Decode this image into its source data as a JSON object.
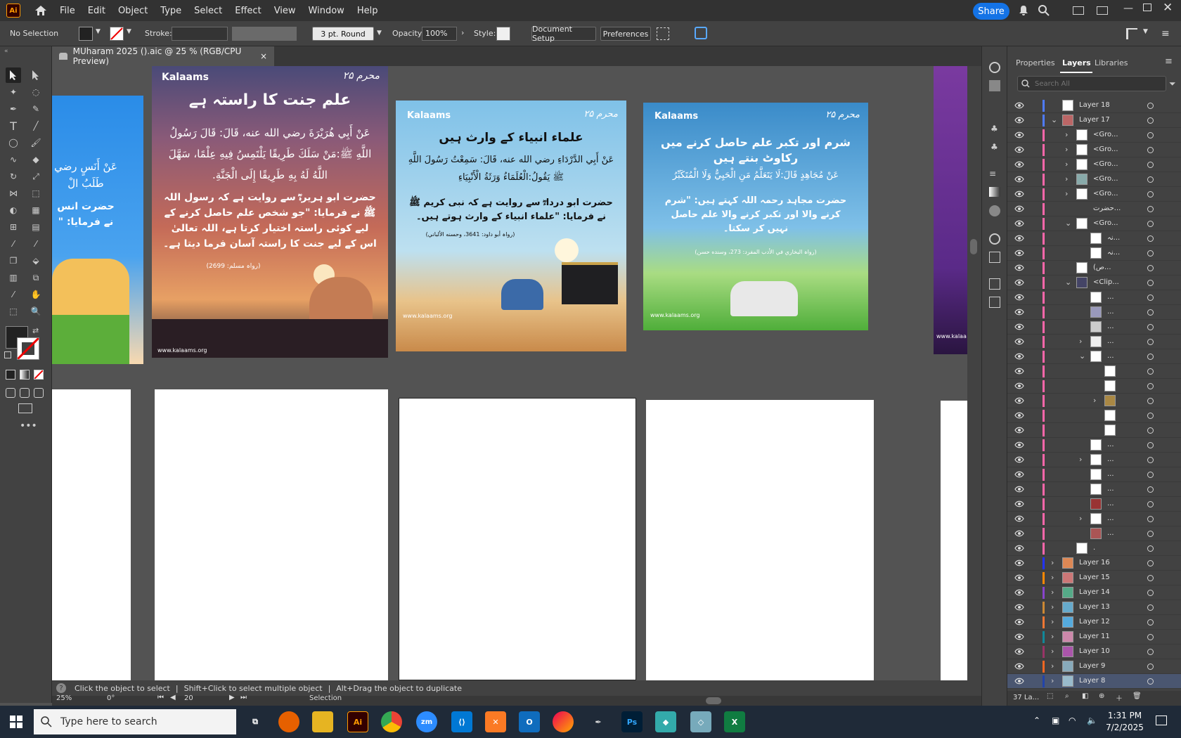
{
  "app": {
    "logo": "Ai",
    "home_icon": "home-icon"
  },
  "menu": [
    "File",
    "Edit",
    "Object",
    "Type",
    "Select",
    "Effect",
    "View",
    "Window",
    "Help"
  ],
  "share_label": "Share",
  "control": {
    "selection": "No Selection",
    "stroke_label": "Stroke:",
    "brush": "3 pt. Round",
    "opacity_label": "Opacity:",
    "opacity_value": "100%",
    "style_label": "Style:",
    "doc_setup": "Document Setup",
    "preferences": "Preferences"
  },
  "document_tab": {
    "title": "MUharam 2025 ().aic @ 25 % (RGB/CPU Preview)",
    "close": "×"
  },
  "artboards": [
    {
      "logo": "Kalaams",
      "title": "علم جنت کا راستہ ہے",
      "arabic": "عَنْ أَبِي هُرَيْرَةَ رضي الله عنه، قَالَ: قَالَ رَسُولُ اللَّهِ ﷺ:مَنْ سَلَكَ طَرِيقًا يَلْتَمِسُ فِيهِ عِلْمًا، سَهَّلَ اللَّهُ لَهُ بِهِ طَرِيقًا إِلَى الْجَنَّةِ.",
      "urdu": "حضرت ابو ہریرہؓ سے روایت ہے کہ رسول اللہ ﷺ نے فرمایا: \"جو شخص علم حاصل کرنے کے لیے کوئی راستہ اختیار کرتا ہے، اللہ تعالیٰ اس کے لیے جنت کا راستہ آسان فرما دیتا ہے۔",
      "ref": "(رواہ مسلم: 2699)",
      "url": "www.kalaams.org"
    },
    {
      "logo": "Kalaams",
      "title": "علماء انبیاء کے وارث ہیں",
      "arabic": "عَنْ أَبِي الدَّرْدَاءِ رضي الله عنه، قَالَ: سَمِعْتُ رَسُولَ اللَّهِ ﷺ يَقُولُ:الْعُلَمَاءُ وَرَثَةُ الْأَنْبِيَاءِ",
      "urdu": "حضرت ابو درداءؓ سے روایت ہے کہ نبی کریم ﷺ نے فرمایا: \"علماء انبیاء کے وارث ہوتے ہیں۔",
      "ref": "(رواہ أبو داود: 3641، وحسنه الألباني)",
      "url": "www.kalaams.org"
    },
    {
      "logo": "Kalaams",
      "title": "شرم اور تکبر علم حاصل کرنے میں رکاوٹ بنتے ہیں",
      "arabic": "عَنْ مُجَاهِدٍ قَالَ:لَا يَتَعَلَّمُ مَنِ الْحَيِيُّ وَلَا الْمُتَكَبِّرُ",
      "urdu": "حضرت مجاہد رحمہ اللہ کہتے ہیں: \"شرم کرنے والا اور تکبر کرنے والا علم حاصل نہیں کر سکتا۔",
      "ref": "(رواہ البخاري في الأدب المفرد: 273، وسنده حسن)",
      "url": "www.kalaams.org"
    }
  ],
  "left_artboard": {
    "arabic": "عَنْ أَنَسٍ رضي",
    "arabic2": "طَلَبُ الْ",
    "urdu": "حضرت انس",
    "urdu2": "نے فرمایا: \""
  },
  "right_artboard": {
    "url": "www.kalaa"
  },
  "panel": {
    "tabs": [
      "Properties",
      "Layers",
      "Libraries"
    ],
    "search_placeholder": "Search All",
    "footer": "37 La...",
    "layers": [
      {
        "name": "Layer 18",
        "indent": 0,
        "chev": "",
        "color": "#4f7bff",
        "thumb": "#fff"
      },
      {
        "name": "Layer 17",
        "indent": 0,
        "chev": "v",
        "color": "#4f7bff",
        "thumb": "#b66"
      },
      {
        "name": "<Gro...",
        "indent": 1,
        "chev": ">",
        "color": "#ff66aa",
        "thumb": "#fff"
      },
      {
        "name": "<Gro...",
        "indent": 1,
        "chev": ">",
        "color": "#ff66aa",
        "thumb": "#fff"
      },
      {
        "name": "<Gro...",
        "indent": 1,
        "chev": ">",
        "color": "#ff66aa",
        "thumb": "#fff"
      },
      {
        "name": "<Gro...",
        "indent": 1,
        "chev": ">",
        "color": "#ff66aa",
        "thumb": "#8aa"
      },
      {
        "name": "<Gro...",
        "indent": 1,
        "chev": ">",
        "color": "#ff66aa",
        "thumb": "#fff"
      },
      {
        "name": "حضرت...",
        "indent": 1,
        "chev": "",
        "color": "#ff66aa",
        "thumb": ""
      },
      {
        "name": "<Gro...",
        "indent": 1,
        "chev": "v",
        "color": "#ff66aa",
        "thumb": "#fff"
      },
      {
        "name": "نہ...",
        "indent": 2,
        "chev": "",
        "color": "#ff66aa",
        "thumb": "#fff"
      },
      {
        "name": "نہ...",
        "indent": 2,
        "chev": "",
        "color": "#ff66aa",
        "thumb": "#fff"
      },
      {
        "name": "(ص...",
        "indent": 1,
        "chev": "",
        "color": "#ff66aa",
        "thumb": "#fff"
      },
      {
        "name": "<Clip...",
        "indent": 1,
        "chev": "v",
        "color": "#ff66aa",
        "thumb": "#446"
      },
      {
        "name": "...",
        "indent": 2,
        "chev": "",
        "color": "#ff66aa",
        "thumb": "#fff"
      },
      {
        "name": "...",
        "indent": 2,
        "chev": "",
        "color": "#ff66aa",
        "thumb": "#99b"
      },
      {
        "name": "...",
        "indent": 2,
        "chev": "",
        "color": "#ff66aa",
        "thumb": "#ccc"
      },
      {
        "name": "...",
        "indent": 2,
        "chev": ">",
        "color": "#ff66aa",
        "thumb": "#eee"
      },
      {
        "name": "...",
        "indent": 2,
        "chev": "v",
        "color": "#ff66aa",
        "thumb": "#fff"
      },
      {
        "name": "",
        "indent": 3,
        "chev": "",
        "color": "#ff66aa",
        "thumb": "#fff"
      },
      {
        "name": "",
        "indent": 3,
        "chev": "",
        "color": "#ff66aa",
        "thumb": "#fff"
      },
      {
        "name": "",
        "indent": 3,
        "chev": ">",
        "color": "#ff66aa",
        "thumb": "#a84"
      },
      {
        "name": "",
        "indent": 3,
        "chev": "",
        "color": "#ff66aa",
        "thumb": "#fff"
      },
      {
        "name": "",
        "indent": 3,
        "chev": "",
        "color": "#ff66aa",
        "thumb": "#fff"
      },
      {
        "name": "...",
        "indent": 2,
        "chev": "",
        "color": "#ff66aa",
        "thumb": "#fff"
      },
      {
        "name": "...",
        "indent": 2,
        "chev": ">",
        "color": "#ff66aa",
        "thumb": "#fff"
      },
      {
        "name": "...",
        "indent": 2,
        "chev": "",
        "color": "#ff66aa",
        "thumb": "#fff"
      },
      {
        "name": "...",
        "indent": 2,
        "chev": "",
        "color": "#ff66aa",
        "thumb": "#fff"
      },
      {
        "name": "...",
        "indent": 2,
        "chev": "",
        "color": "#ff66aa",
        "thumb": "#933"
      },
      {
        "name": "...",
        "indent": 2,
        "chev": ">",
        "color": "#ff66aa",
        "thumb": "#fff"
      },
      {
        "name": "...",
        "indent": 2,
        "chev": "",
        "color": "#ff66aa",
        "thumb": "#a55"
      },
      {
        "name": ".",
        "indent": 1,
        "chev": "",
        "color": "#ff66aa",
        "thumb": "#fff"
      },
      {
        "name": "Layer 16",
        "indent": 0,
        "chev": ">",
        "color": "#2233ff",
        "thumb": "#d85"
      },
      {
        "name": "Layer 15",
        "indent": 0,
        "chev": ">",
        "color": "#ff8800",
        "thumb": "#c77"
      },
      {
        "name": "Layer 14",
        "indent": 0,
        "chev": ">",
        "color": "#8844cc",
        "thumb": "#5a8"
      },
      {
        "name": "Layer 13",
        "indent": 0,
        "chev": ">",
        "color": "#cc8833",
        "thumb": "#6ac"
      },
      {
        "name": "Layer 12",
        "indent": 0,
        "chev": ">",
        "color": "#ee7733",
        "thumb": "#5ad"
      },
      {
        "name": "Layer 11",
        "indent": 0,
        "chev": ">",
        "color": "#118899",
        "thumb": "#c8a"
      },
      {
        "name": "Layer 10",
        "indent": 0,
        "chev": ">",
        "color": "#993366",
        "thumb": "#a5a"
      },
      {
        "name": "Layer 9",
        "indent": 0,
        "chev": ">",
        "color": "#ee6622",
        "thumb": "#8ab"
      },
      {
        "name": "Layer 8",
        "indent": 0,
        "chev": ">",
        "color": "#2244aa",
        "thumb": "#9bc"
      }
    ]
  },
  "status": {
    "hint_1": "Click the object to select",
    "hint_2": "Shift+Click to select multiple object",
    "hint_3": "Alt+Drag the object to duplicate",
    "zoom": "25%",
    "rotate": "0°",
    "artboard_num": "20",
    "tool": "Selection"
  },
  "taskbar": {
    "search_placeholder": "Type here to search",
    "time": "1:31 PM",
    "date": "7/2/2025"
  }
}
